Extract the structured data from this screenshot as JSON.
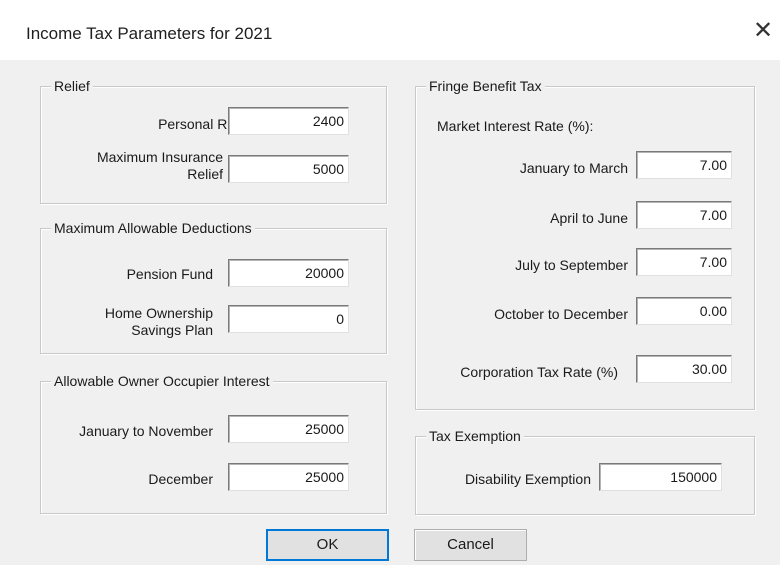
{
  "window": {
    "title": "Income Tax Parameters for 2021",
    "close_glyph": "✕"
  },
  "relief": {
    "legend": "Relief",
    "personal_relief": {
      "label": "Personal Relief",
      "value": "2400"
    },
    "max_insurance_relief": {
      "label_line1": "Maximum Insurance",
      "label_line2": "Relief",
      "value": "5000"
    }
  },
  "deductions": {
    "legend": "Maximum Allowable Deductions",
    "pension_fund": {
      "label": "Pension Fund",
      "value": "20000"
    },
    "home_ownership": {
      "label_line1": "Home Ownership",
      "label_line2": "Savings Plan",
      "value": "0"
    }
  },
  "interest": {
    "legend": "Allowable Owner Occupier Interest",
    "jan_nov": {
      "label": "January to November",
      "value": "25000"
    },
    "december": {
      "label": "December",
      "value": "25000"
    }
  },
  "fringe": {
    "legend": "Fringe Benefit Tax",
    "market_rate_label": "Market Interest Rate (%):",
    "q1": {
      "label": "January to March",
      "value": "7.00"
    },
    "q2": {
      "label": "April to June",
      "value": "7.00"
    },
    "q3": {
      "label": "July to September",
      "value": "7.00"
    },
    "q4": {
      "label": "October to December",
      "value": "0.00"
    },
    "corp_tax": {
      "label": "Corporation Tax Rate (%)",
      "value": "30.00"
    }
  },
  "exemption": {
    "legend": "Tax Exemption",
    "disability": {
      "label": "Disability Exemption",
      "value": "150000"
    }
  },
  "buttons": {
    "ok": "OK",
    "cancel": "Cancel"
  }
}
